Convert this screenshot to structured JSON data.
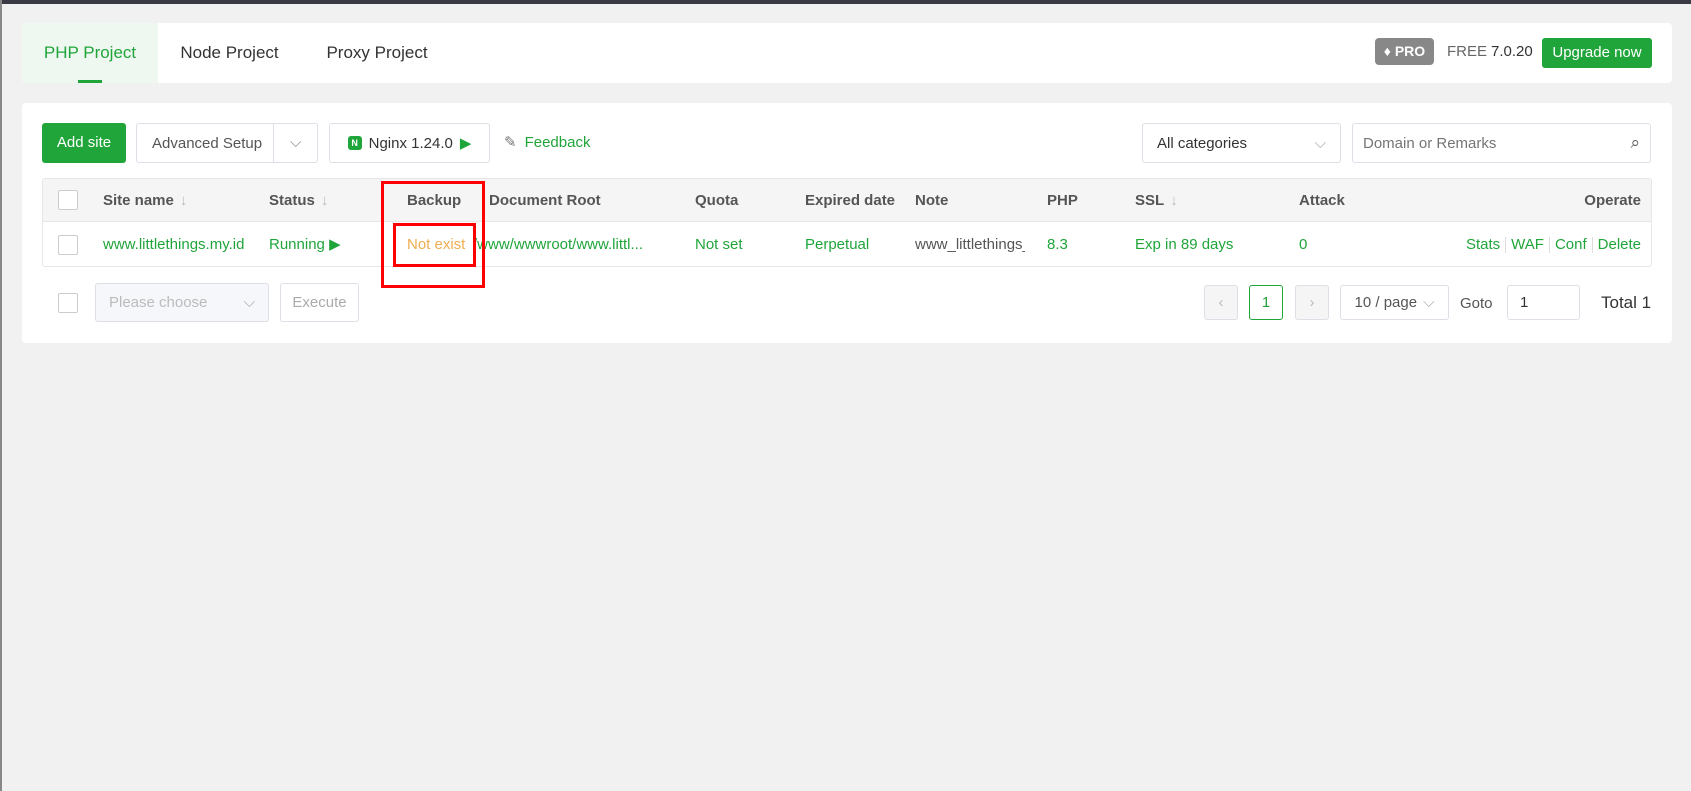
{
  "tabs": [
    {
      "label": "PHP Project",
      "active": true
    },
    {
      "label": "Node Project"
    },
    {
      "label": "Proxy Project"
    }
  ],
  "header": {
    "pro_badge": "PRO",
    "edition": "FREE",
    "version": "7.0.20",
    "upgrade_label": "Upgrade now"
  },
  "toolbar": {
    "add_site": "Add site",
    "advanced_setup": "Advanced Setup",
    "nginx": "Nginx 1.24.0",
    "feedback": "Feedback",
    "category": "All categories",
    "search_placeholder": "Domain or Remarks"
  },
  "table": {
    "headers": [
      "Site name",
      "Status",
      "Backup",
      "Document Root",
      "Quota",
      "Expired date",
      "Note",
      "PHP",
      "SSL",
      "Attack",
      "Operate"
    ],
    "rows": [
      {
        "site": "www.littlethings.my.id",
        "status": "Running",
        "backup": "Not exist",
        "root": "/www/wwwroot/www.littl...",
        "quota": "Not set",
        "expired": "Perpetual",
        "note": "www_littlethings_",
        "php": "8.3",
        "ssl": "Exp in 89 days",
        "attack": "0",
        "ops": [
          "Stats",
          "WAF",
          "Conf",
          "Delete"
        ]
      }
    ]
  },
  "footer": {
    "batch_placeholder": "Please choose",
    "execute": "Execute",
    "page": "1",
    "page_size": "10 / page",
    "goto_label": "Goto",
    "goto_value": "1",
    "total": "Total 1"
  },
  "colors": {
    "accent": "#20a53a",
    "warning": "#f0ad4e",
    "highlight": "#ff0000"
  }
}
